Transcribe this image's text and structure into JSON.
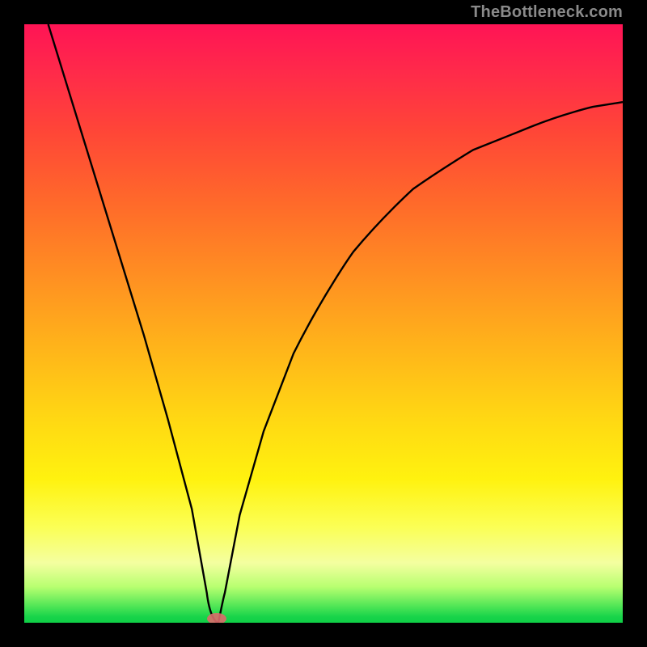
{
  "watermark": {
    "text": "TheBottleneck.com"
  },
  "chart_data": {
    "type": "line",
    "title": "",
    "xlabel": "",
    "ylabel": "",
    "xlim": [
      0,
      100
    ],
    "ylim": [
      0,
      100
    ],
    "series": [
      {
        "name": "bottleneck-curve",
        "x": [
          4,
          8,
          12,
          16,
          20,
          24,
          28,
          30.5,
          31.5,
          33,
          36,
          40,
          45,
          50,
          55,
          60,
          65,
          70,
          75,
          80,
          85,
          90,
          95,
          100
        ],
        "y": [
          100,
          87,
          74,
          61,
          48,
          34,
          19,
          5,
          0,
          5,
          18,
          32,
          45,
          55,
          62,
          68,
          72.5,
          76,
          79,
          81.5,
          83.5,
          85,
          86.2,
          87
        ]
      }
    ],
    "markers": [
      {
        "name": "optimal-point",
        "x": 31.5,
        "y": 0,
        "color": "#d85a5a"
      }
    ],
    "background_gradient": {
      "top": "#ff1455",
      "bottom": "#0fcf46"
    }
  }
}
